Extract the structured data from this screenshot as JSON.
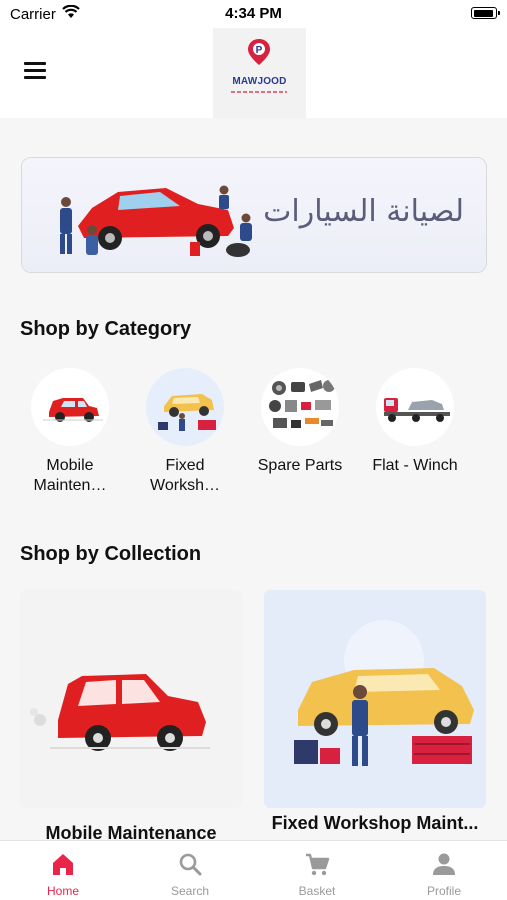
{
  "status_bar": {
    "carrier": "Carrier",
    "time": "4:34 PM"
  },
  "header": {
    "logo_text": "MAWJOOD",
    "menu_icon": "hamburger-menu-icon"
  },
  "banner": {
    "text": "لصيانة السيارات"
  },
  "categories": {
    "title": "Shop by Category",
    "items": [
      {
        "label": "Mobile Mainten…",
        "icon": "red-car-icon"
      },
      {
        "label": "Fixed Worksh…",
        "icon": "workshop-lift-icon"
      },
      {
        "label": "Spare Parts",
        "icon": "spare-parts-icon"
      },
      {
        "label": "Flat - Winch",
        "icon": "tow-truck-icon"
      }
    ]
  },
  "collections": {
    "title": "Shop by Collection",
    "items": [
      {
        "label": "Mobile Maintenance"
      },
      {
        "label": "Fixed Workshop Maint..."
      }
    ]
  },
  "tab_bar": {
    "items": [
      {
        "label": "Home",
        "icon": "home-icon",
        "active": true
      },
      {
        "label": "Search",
        "icon": "search-icon",
        "active": false
      },
      {
        "label": "Basket",
        "icon": "cart-icon",
        "active": false
      },
      {
        "label": "Profile",
        "icon": "profile-icon",
        "active": false
      }
    ]
  },
  "colors": {
    "accent": "#e8264c",
    "inactive": "#9a9a9a",
    "brand_blue": "#2b3a8f"
  }
}
